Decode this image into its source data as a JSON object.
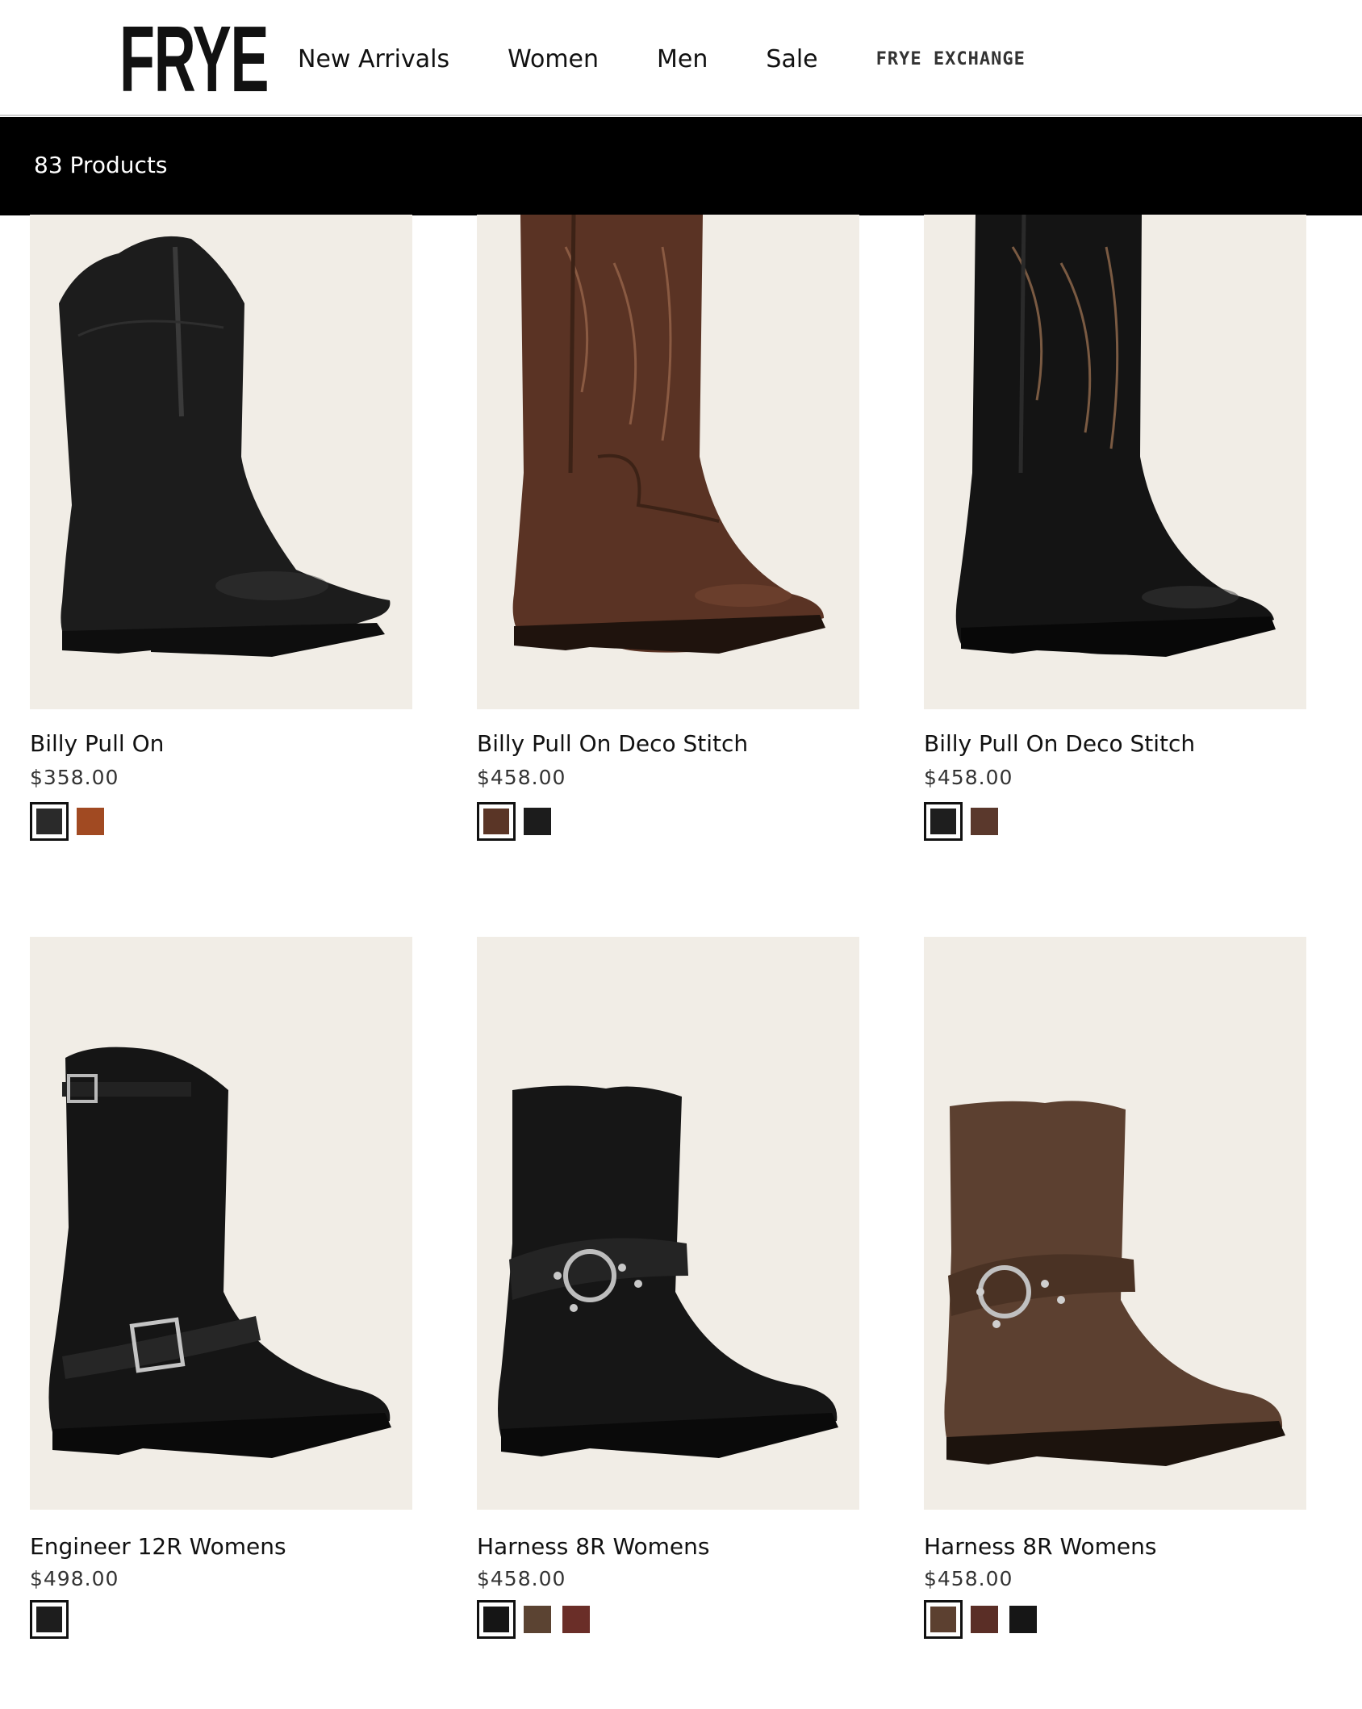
{
  "header": {
    "logo": "FRYE",
    "nav": [
      "New Arrivals",
      "Women",
      "Men",
      "Sale"
    ],
    "exchange": "FRYE EXCHANGE"
  },
  "count_bar": {
    "text": "83 Products"
  },
  "products": [
    {
      "name": "Billy Pull On",
      "price": "$358.00",
      "image": "boot-black-pull-on",
      "swatches": [
        {
          "color": "#2a2a2a",
          "selected": true
        },
        {
          "color": "#a14a22",
          "selected": false
        }
      ]
    },
    {
      "name": "Billy Pull On Deco Stitch",
      "price": "$458.00",
      "image": "boot-brown-deco-stitch",
      "swatches": [
        {
          "color": "#5a3526",
          "selected": true
        },
        {
          "color": "#1c1c1c",
          "selected": false
        }
      ]
    },
    {
      "name": "Billy Pull On Deco Stitch",
      "price": "$458.00",
      "image": "boot-black-deco-stitch",
      "swatches": [
        {
          "color": "#1e1e1e",
          "selected": true
        },
        {
          "color": "#5a382c",
          "selected": false
        }
      ]
    },
    {
      "name": "Engineer 12R Womens",
      "price": "$498.00",
      "image": "boot-black-engineer",
      "swatches": [
        {
          "color": "#1d1d1d",
          "selected": true
        }
      ]
    },
    {
      "name": "Harness 8R Womens",
      "price": "$458.00",
      "image": "boot-black-harness",
      "swatches": [
        {
          "color": "#151515",
          "selected": true
        },
        {
          "color": "#5b4332",
          "selected": false
        },
        {
          "color": "#6a2e28",
          "selected": false
        }
      ]
    },
    {
      "name": "Harness 8R Womens",
      "price": "$458.00",
      "image": "boot-brown-harness",
      "swatches": [
        {
          "color": "#5c4030",
          "selected": true
        },
        {
          "color": "#5a2e26",
          "selected": false
        },
        {
          "color": "#161616",
          "selected": false
        }
      ]
    }
  ],
  "colors": {
    "image_bg": "#f1ede6",
    "bar": "#000000",
    "text": "#111111"
  }
}
